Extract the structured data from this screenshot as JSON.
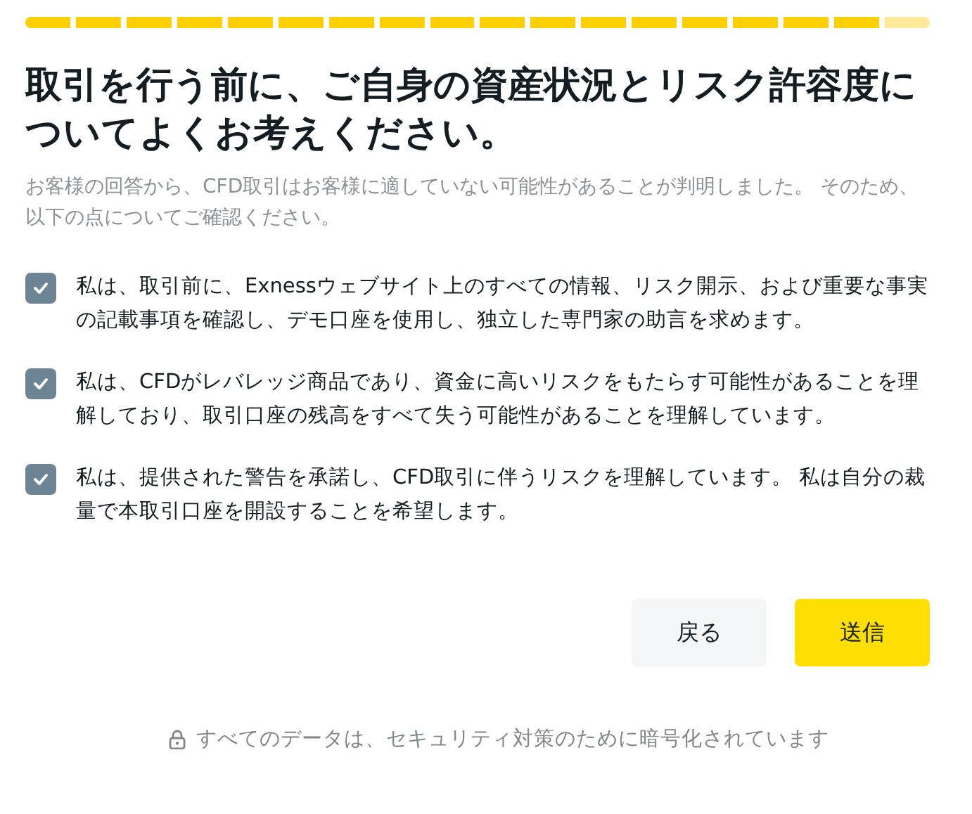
{
  "progress": {
    "steps": [
      {
        "done": true
      },
      {
        "done": true
      },
      {
        "done": true
      },
      {
        "done": true
      },
      {
        "done": true
      },
      {
        "done": true
      },
      {
        "done": true
      },
      {
        "done": true
      },
      {
        "done": true
      },
      {
        "done": true
      },
      {
        "done": true
      },
      {
        "done": true
      },
      {
        "done": true
      },
      {
        "done": true
      },
      {
        "done": true
      },
      {
        "done": true
      },
      {
        "done": true
      },
      {
        "done": false
      }
    ]
  },
  "title": "取引を行う前に、ご自身の資産状況とリスク許容度についてよくお考えください。",
  "description": "お客様の回答から、CFD取引はお客様に適していない可能性があることが判明しました。 そのため、以下の点についてご確認ください。",
  "confirmations": [
    {
      "text": "私は、取引前に、Exnessウェブサイト上のすべての情報、リスク開示、および重要な事実の記載事項を確認し、デモ口座を使用し、独立した専門家の助言を求めます。",
      "checked": true
    },
    {
      "text": "私は、CFDがレバレッジ商品であり、資金に高いリスクをもたらす可能性があることを理解しており、取引口座の残高をすべて失う可能性があることを理解しています。",
      "checked": true
    },
    {
      "text": "私は、提供された警告を承諾し、CFD取引に伴うリスクを理解しています。 私は自分の裁量で本取引口座を開設することを希望します。",
      "checked": true
    }
  ],
  "buttons": [
    {
      "label": "戻る",
      "kind": "secondary"
    },
    {
      "label": "送信",
      "kind": "primary"
    }
  ],
  "footer": "すべてのデータは、セキュリティ対策のために暗号化されています"
}
